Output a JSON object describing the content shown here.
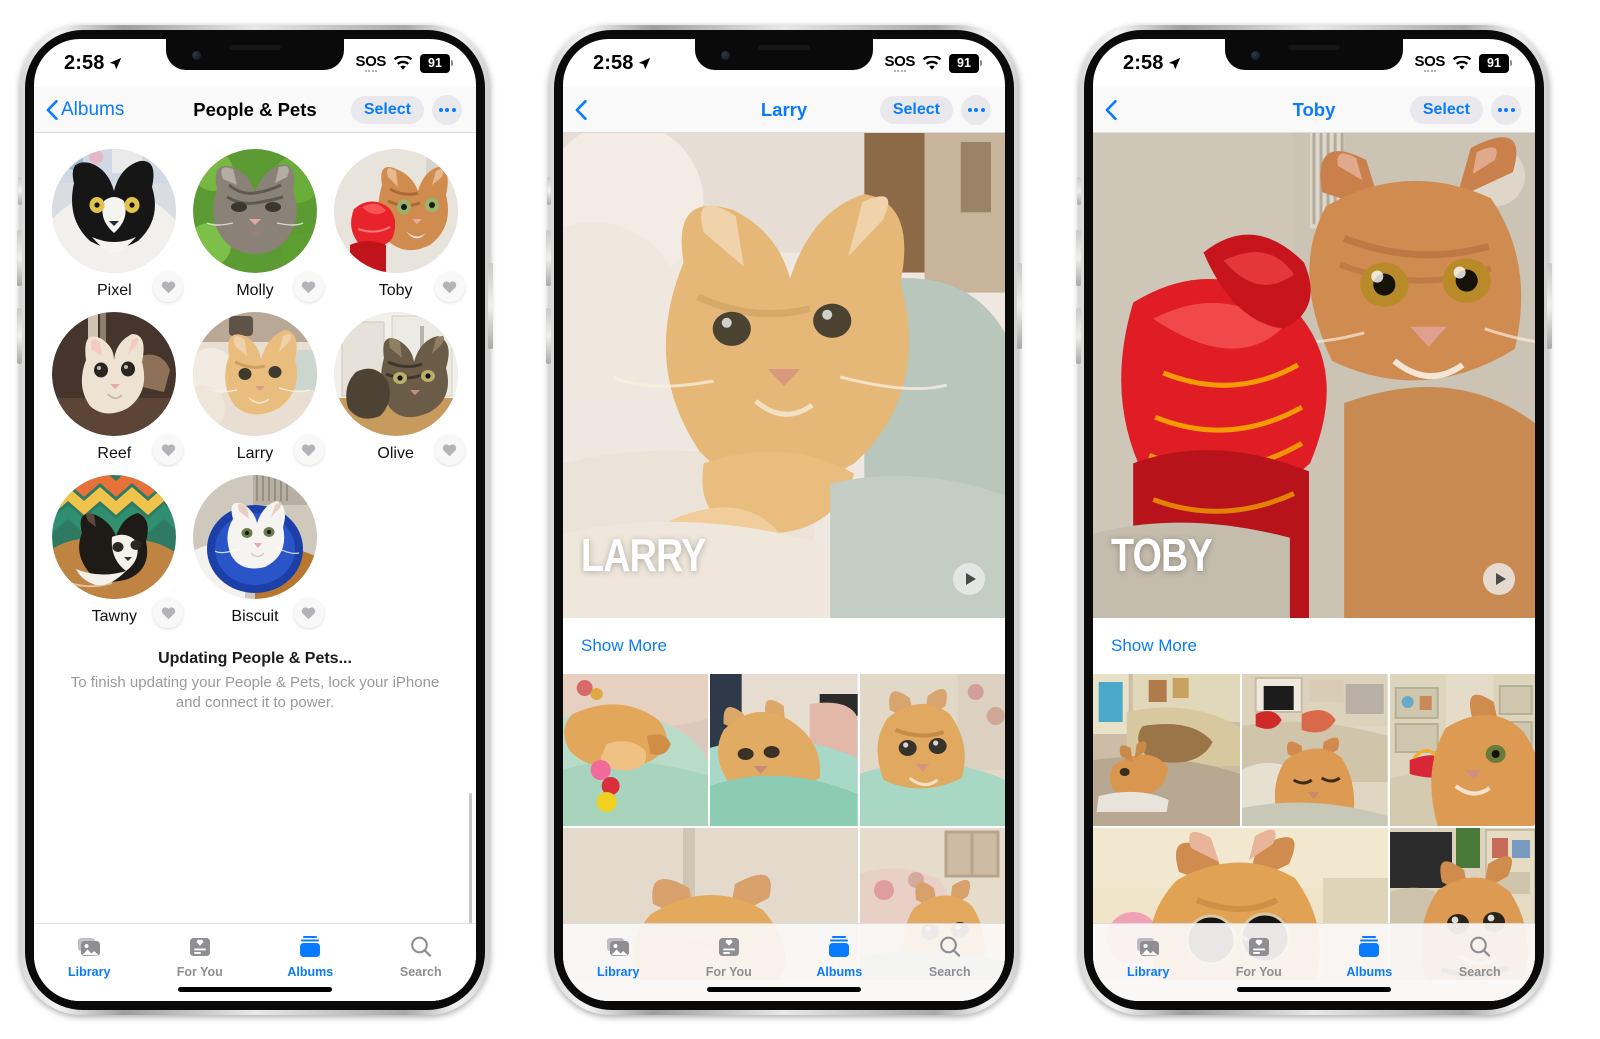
{
  "status_bar": {
    "time": "2:58",
    "location_icon": "location-arrow-icon",
    "sos": "SOS",
    "wifi_icon": "wifi-icon",
    "battery": "91"
  },
  "colors": {
    "accent_blue": "#0a7bff",
    "tab_inactive_gray": "#8e8e93",
    "nav_chrome": "#f9f9f9",
    "select_pill": "#e9e9ed",
    "heart_gray": "#b4b4b8"
  },
  "phones": [
    {
      "id": "people-and-pets",
      "nav": {
        "back_label": "Albums",
        "back_icon": "chevron-left-icon",
        "title": "People & Pets",
        "title_color": "black",
        "select_label": "Select",
        "more_icon": "ellipsis-icon"
      },
      "pets": [
        {
          "name": "Pixel",
          "favorite_icon": "heart-icon"
        },
        {
          "name": "Molly",
          "favorite_icon": "heart-icon"
        },
        {
          "name": "Toby",
          "favorite_icon": "heart-icon"
        },
        {
          "name": "Reef",
          "favorite_icon": "heart-icon"
        },
        {
          "name": "Larry",
          "favorite_icon": "heart-icon"
        },
        {
          "name": "Olive",
          "favorite_icon": "heart-icon"
        },
        {
          "name": "Tawny",
          "favorite_icon": "heart-icon"
        },
        {
          "name": "Biscuit",
          "favorite_icon": "heart-icon"
        }
      ],
      "updating": {
        "title": "Updating People & Pets...",
        "subtitle": "To finish updating your People & Pets, lock your iPhone and connect it to power."
      }
    },
    {
      "id": "larry-album",
      "nav": {
        "back_label": "",
        "back_icon": "chevron-left-icon",
        "title": "Larry",
        "title_color": "blue",
        "select_label": "Select",
        "more_icon": "ellipsis-icon"
      },
      "hero": {
        "name_overlay": "LARRY",
        "play_icon": "play-icon"
      },
      "show_more_label": "Show More"
    },
    {
      "id": "toby-album",
      "nav": {
        "back_label": "",
        "back_icon": "chevron-left-icon",
        "title": "Toby",
        "title_color": "blue",
        "select_label": "Select",
        "more_icon": "ellipsis-icon"
      },
      "hero": {
        "name_overlay": "TOBY",
        "play_icon": "play-icon"
      },
      "show_more_label": "Show More"
    }
  ],
  "tab_bar": {
    "items": [
      {
        "label": "Library",
        "icon": "photos-library-icon",
        "active": false,
        "label_color": "blue"
      },
      {
        "label": "For You",
        "icon": "for-you-icon",
        "active": false,
        "label_color": "gray"
      },
      {
        "label": "Albums",
        "icon": "albums-icon",
        "active": true,
        "label_color": "blue"
      },
      {
        "label": "Search",
        "icon": "search-icon",
        "active": false,
        "label_color": "gray"
      }
    ]
  }
}
